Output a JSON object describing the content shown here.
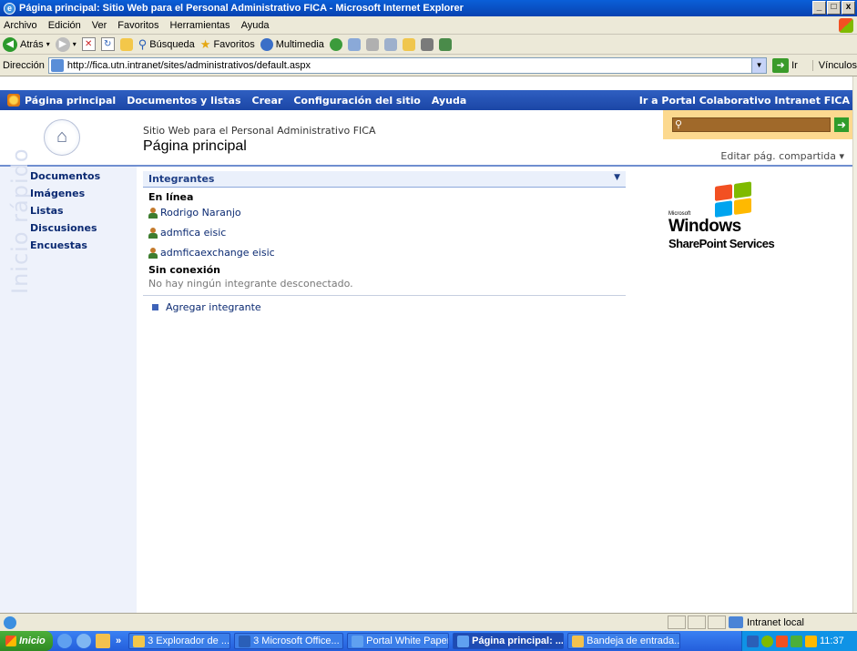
{
  "window": {
    "title": "Página principal: Sitio Web para el Personal Administrativo FICA - Microsoft Internet Explorer",
    "controls": [
      "_",
      "□",
      "x"
    ]
  },
  "menu": [
    "Archivo",
    "Edición",
    "Ver",
    "Favoritos",
    "Herramientas",
    "Ayuda"
  ],
  "toolbar": {
    "back": "Atrás",
    "search": "Búsqueda",
    "favorites": "Favoritos",
    "media": "Multimedia"
  },
  "address": {
    "label": "Dirección",
    "url": "http://fica.utn.intranet/sites/administrativos/default.aspx",
    "go": "Ir",
    "links": "Vínculos"
  },
  "sp_nav": {
    "items": [
      "Página principal",
      "Documentos y listas",
      "Crear",
      "Configuración del sitio",
      "Ayuda"
    ],
    "right_link": "Ir a Portal Colaborativo Intranet FICA"
  },
  "header": {
    "site_name": "Sitio Web para el Personal Administrativo FICA",
    "page_title": "Página principal",
    "edit_shared": "Editar pág. compartida ▾"
  },
  "quick_launch": {
    "watermark": "Inicio rápido",
    "items": [
      "Documentos",
      "Imágenes",
      "Listas",
      "Discusiones",
      "Encuestas"
    ]
  },
  "members": {
    "title": "Integrantes",
    "online_label": "En línea",
    "online": [
      "Rodrigo Naranjo",
      "admfica eisic",
      "admficaexchange eisic"
    ],
    "offline_label": "Sin conexión",
    "offline_empty": "No hay ningún integrante desconectado.",
    "add_label": "Agregar integrante"
  },
  "logo": {
    "microsoft": "Microsoft",
    "windows": "Windows",
    "product": "SharePoint Services"
  },
  "status": {
    "zone": "Intranet local"
  },
  "taskbar": {
    "start": "Inicio",
    "overflow": "»",
    "tasks": [
      "3 Explorador de ...",
      "3 Microsoft Office...",
      "Portal White Paper ...",
      "Página principal: ...",
      "Bandeja de entrada..."
    ],
    "clock": "11:37"
  }
}
